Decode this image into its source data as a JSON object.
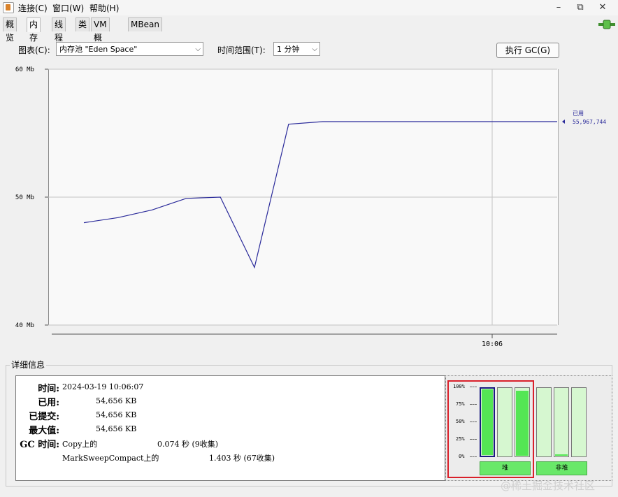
{
  "menubar": {
    "items": [
      "连接(C)",
      "窗口(W)",
      "帮助(H)"
    ],
    "window_buttons": [
      "–",
      "⧉",
      "✕"
    ]
  },
  "tabs": [
    {
      "label": "概览",
      "active": false
    },
    {
      "label": "内存",
      "active": true
    },
    {
      "label": "线程",
      "active": false
    },
    {
      "label": "类",
      "active": false
    },
    {
      "label": "VM 概要",
      "active": false
    },
    {
      "label": "MBean",
      "active": false
    }
  ],
  "controls": {
    "chart_label": "图表(C):",
    "chart_value": "内存池 \"Eden Space\"",
    "time_label": "时间范围(T):",
    "time_value": "1 分钟",
    "gc_button": "执行 GC(G)"
  },
  "chart_data": {
    "type": "line",
    "y_tick_labels": [
      "60 Mb",
      "50 Mb",
      "40 Mb"
    ],
    "x_tick_labels": [
      "10:06"
    ],
    "ylim": [
      40,
      60
    ],
    "grid": true,
    "series": [
      {
        "name": "已用",
        "color": "#2a2a9a",
        "x": [
          0,
          1,
          2,
          3,
          4,
          5,
          6,
          7,
          8,
          9,
          10,
          11,
          12,
          13
        ],
        "values": [
          48.0,
          48.4,
          49.0,
          49.9,
          50.0,
          44.5,
          55.7,
          55.9,
          55.9,
          55.9,
          55.9,
          55.9,
          55.9,
          55.9
        ]
      }
    ],
    "legend": {
      "label": "已用",
      "value": "55,967,744"
    }
  },
  "details": {
    "title": "详细信息",
    "rows": [
      {
        "label": "时间:",
        "value": "2024-03-19 10:06:07"
      },
      {
        "label": "已用:",
        "value": "54,656 KB"
      },
      {
        "label": "已提交:",
        "value": "54,656 KB"
      },
      {
        "label": "最大值:",
        "value": "54,656 KB"
      }
    ],
    "gc_label": "GC 时间:",
    "gc_rows": [
      {
        "name": "Copy上的",
        "time": "0.074 秒 (9收集)"
      },
      {
        "name": "MarkSweepCompact上的",
        "time": "1.403 秒 (67收集)"
      }
    ]
  },
  "bars": {
    "pct_labels": [
      "100%",
      "75%",
      "50%",
      "25%",
      "0%"
    ],
    "heap": [
      1.0,
      0.0,
      0.97
    ],
    "nonheap": [
      0.0,
      0.04,
      0.0
    ],
    "heap_label": "堆",
    "nonheap_label": "非堆"
  },
  "watermark": "@稀土掘金技术社区"
}
